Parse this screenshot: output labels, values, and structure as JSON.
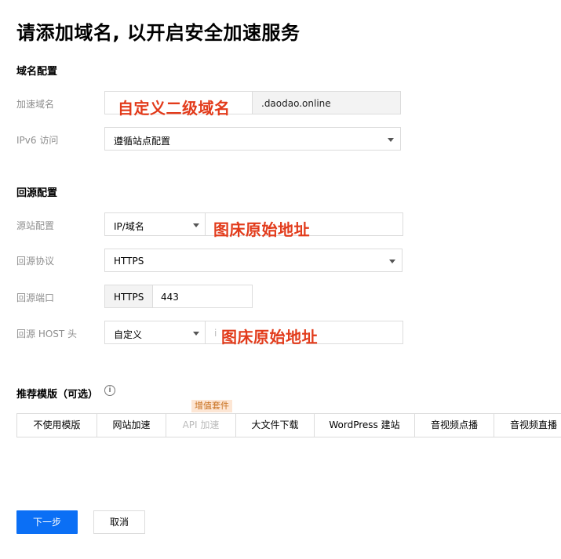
{
  "page_title": "请添加域名, 以开启安全加速服务",
  "domain_config": {
    "section_title": "域名配置",
    "accel_domain_label": "加速域名",
    "accel_domain_annotation": "自定义二级域名",
    "domain_suffix": ".daodao.online",
    "ipv6_label": "IPv6 访问",
    "ipv6_value": "遵循站点配置"
  },
  "origin_config": {
    "section_title": "回源配置",
    "origin_label": "源站配置",
    "origin_type": "IP/域名",
    "origin_annotation": "图床原始地址",
    "protocol_label": "回源协议",
    "protocol_value": "HTTPS",
    "port_label": "回源端口",
    "port_prefix": "HTTPS",
    "port_value": "443",
    "host_label": "回源 HOST 头",
    "host_type": "自定义",
    "host_placeholder": "i",
    "host_annotation": "图床原始地址"
  },
  "templates": {
    "section_title": "推荐模版（可选）",
    "info_icon_glyph": "i",
    "badge": "增值套件",
    "tabs": [
      "不使用模版",
      "网站加速",
      "API 加速",
      "大文件下载",
      "WordPress 建站",
      "音视频点播",
      "音视频直播"
    ]
  },
  "buttons": {
    "next": "下一步",
    "cancel": "取消"
  },
  "colors": {
    "primary": "#0b6ff5",
    "annotation": "#e23b1b",
    "badge_bg": "#fde6d4",
    "badge_text": "#c8701e"
  }
}
